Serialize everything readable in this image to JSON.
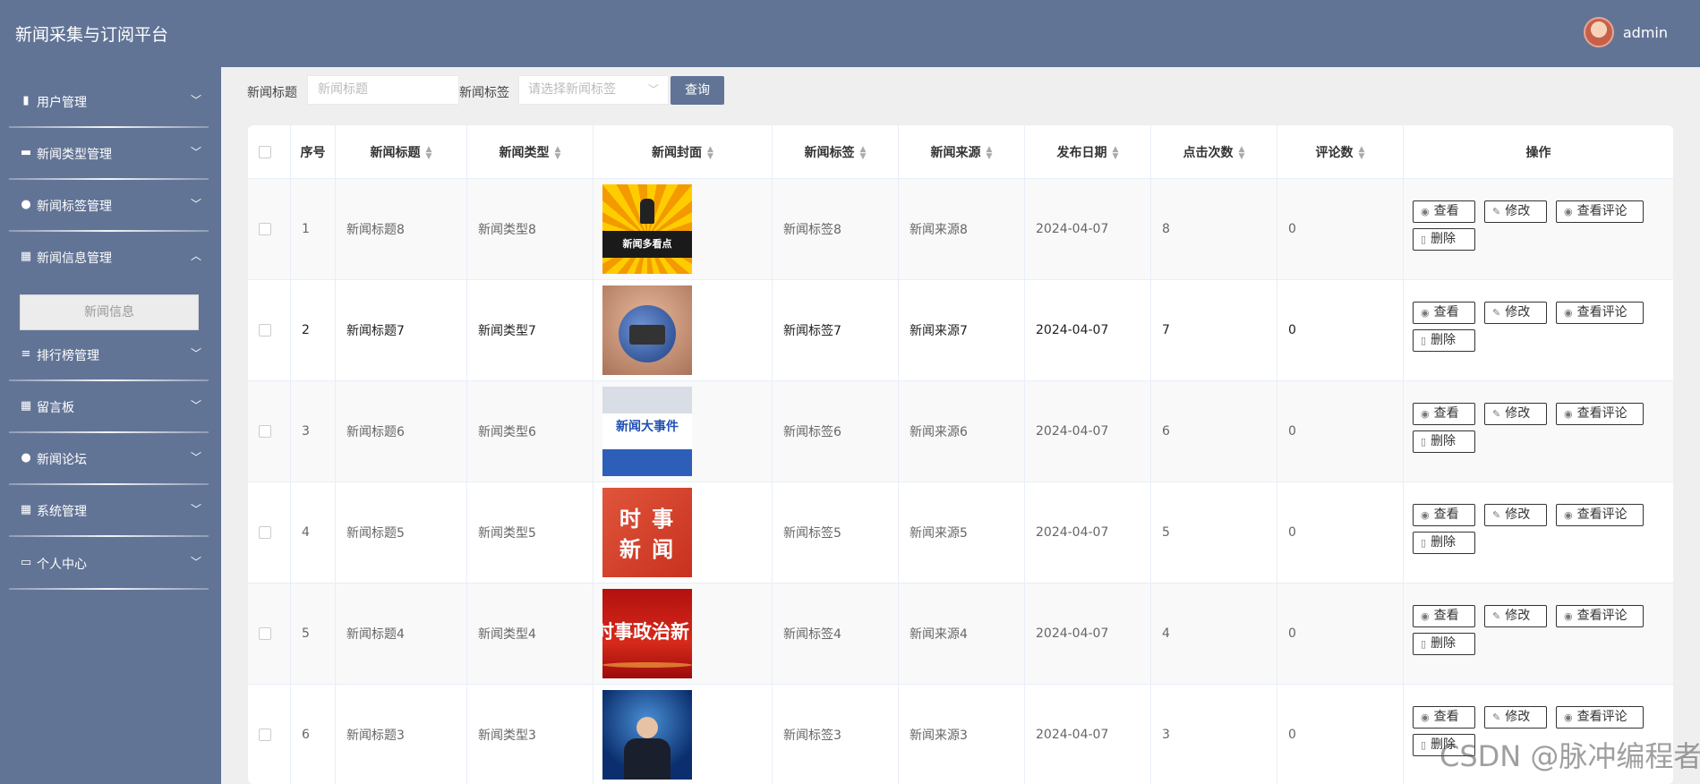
{
  "topbar": {
    "title": "新闻采集与订阅平台",
    "username": "admin"
  },
  "sidebar": {
    "items": [
      {
        "label": "用户管理",
        "icon": "chart-icon"
      },
      {
        "label": "新闻类型管理",
        "icon": "monitor-icon"
      },
      {
        "label": "新闻标签管理",
        "icon": "user-icon"
      },
      {
        "label": "新闻信息管理",
        "icon": "grid-icon"
      },
      {
        "label": "排行榜管理",
        "icon": "list-icon"
      },
      {
        "label": "留言板",
        "icon": "grid-icon"
      },
      {
        "label": "新闻论坛",
        "icon": "bulb-icon"
      },
      {
        "label": "系统管理",
        "icon": "grid-icon"
      },
      {
        "label": "个人中心",
        "icon": "card-icon"
      }
    ],
    "submenu": {
      "label": "新闻信息"
    }
  },
  "search": {
    "title_label": "新闻标题",
    "title_placeholder": "新闻标题",
    "tag_label": "新闻标签",
    "tag_placeholder": "请选择新闻标签",
    "query_button": "查询"
  },
  "table": {
    "headers": {
      "index": "序号",
      "title": "新闻标题",
      "type": "新闻类型",
      "cover": "新闻封面",
      "tag": "新闻标签",
      "source": "新闻来源",
      "date": "发布日期",
      "clicks": "点击次数",
      "comments": "评论数",
      "actions": "操作"
    },
    "action_labels": {
      "view": "查看",
      "edit": "修改",
      "view_comments": "查看评论",
      "delete": "删除"
    },
    "rows": [
      {
        "index": "1",
        "title": "新闻标题8",
        "type": "新闻类型8",
        "cover_text": "新闻多看点",
        "tag": "新闻标签8",
        "source": "新闻来源8",
        "date": "2024-04-07",
        "clicks": "8",
        "comments": "0"
      },
      {
        "index": "2",
        "title": "新闻标题7",
        "type": "新闻类型7",
        "cover_text": "",
        "tag": "新闻标签7",
        "source": "新闻来源7",
        "date": "2024-04-07",
        "clicks": "7",
        "comments": "0"
      },
      {
        "index": "3",
        "title": "新闻标题6",
        "type": "新闻类型6",
        "cover_text": "新闻大事件",
        "tag": "新闻标签6",
        "source": "新闻来源6",
        "date": "2024-04-07",
        "clicks": "6",
        "comments": "0"
      },
      {
        "index": "4",
        "title": "新闻标题5",
        "type": "新闻类型5",
        "cover_text": "时 事 新 闻",
        "tag": "新闻标签5",
        "source": "新闻来源5",
        "date": "2024-04-07",
        "clicks": "5",
        "comments": "0"
      },
      {
        "index": "5",
        "title": "新闻标题4",
        "type": "新闻类型4",
        "cover_text": "时事政治新",
        "tag": "新闻标签4",
        "source": "新闻来源4",
        "date": "2024-04-07",
        "clicks": "4",
        "comments": "0"
      },
      {
        "index": "6",
        "title": "新闻标题3",
        "type": "新闻类型3",
        "cover_text": "",
        "tag": "新闻标签3",
        "source": "新闻来源3",
        "date": "2024-04-07",
        "clicks": "3",
        "comments": "0"
      }
    ]
  },
  "watermark": "CSDN @脉冲编程者"
}
